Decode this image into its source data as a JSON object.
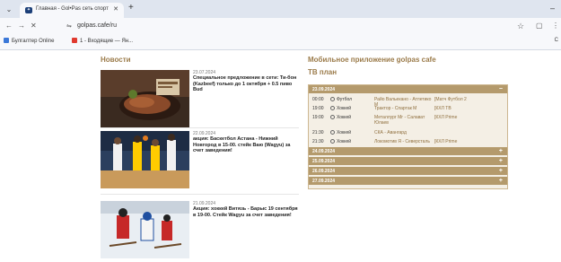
{
  "browser": {
    "tab_title": "Главная - Gol•Pas сеть спорт",
    "url": "golpas.cafe/ru",
    "bookmarks": [
      "Булгалтер Online",
      "1 - Входящие — Ян..."
    ],
    "bookmarks_right": "С"
  },
  "page": {
    "news_title": "Новости",
    "app_title": "Мобильное приложение golpas cafe",
    "tv_title": "ТВ план"
  },
  "news": [
    {
      "date": "23.07.2024",
      "text": "Специальное предложение в сети: Ти-бон (Kazbeef) только до 1 октября + 0.5 пиво Bud"
    },
    {
      "date": "22.09.2024",
      "text": "акция: Баскетбол Астана - Нижний Новгород в 15-00. стейк Ваю (Wagyu) за счет заведения!"
    },
    {
      "date": "21.09.2024",
      "text": "Акция: хоккей Витязь - Барыс 19 сентября в 19-00. Стейк Wagyu за счет заведения!"
    }
  ],
  "tv_plan": {
    "open_day": "23.09.2024",
    "events": [
      {
        "time": "00:00",
        "sport": "Футбол",
        "match": "Райо Вальекано - Атлетико М",
        "channel": "[Матч Футбол 2"
      },
      {
        "time": "19:00",
        "sport": "Хоккей",
        "match": "Трактор - Спартак М",
        "channel": "[КХЛ ТВ"
      },
      {
        "time": "19:00",
        "sport": "Хоккей",
        "match": "Металлург Мг - Салават Юлаев",
        "channel": "[КХЛ Prime"
      },
      {
        "time": "21:30",
        "sport": "Хоккей",
        "match": "СКА - Авангард",
        "channel": ""
      },
      {
        "time": "21:30",
        "sport": "Хоккей",
        "match": "Локомотив Я - Северсталь",
        "channel": "[КХЛ Prime"
      }
    ],
    "collapsed_days": [
      "24.09.2024",
      "25.09.2024",
      "26.09.2024",
      "27.09.2024"
    ]
  }
}
